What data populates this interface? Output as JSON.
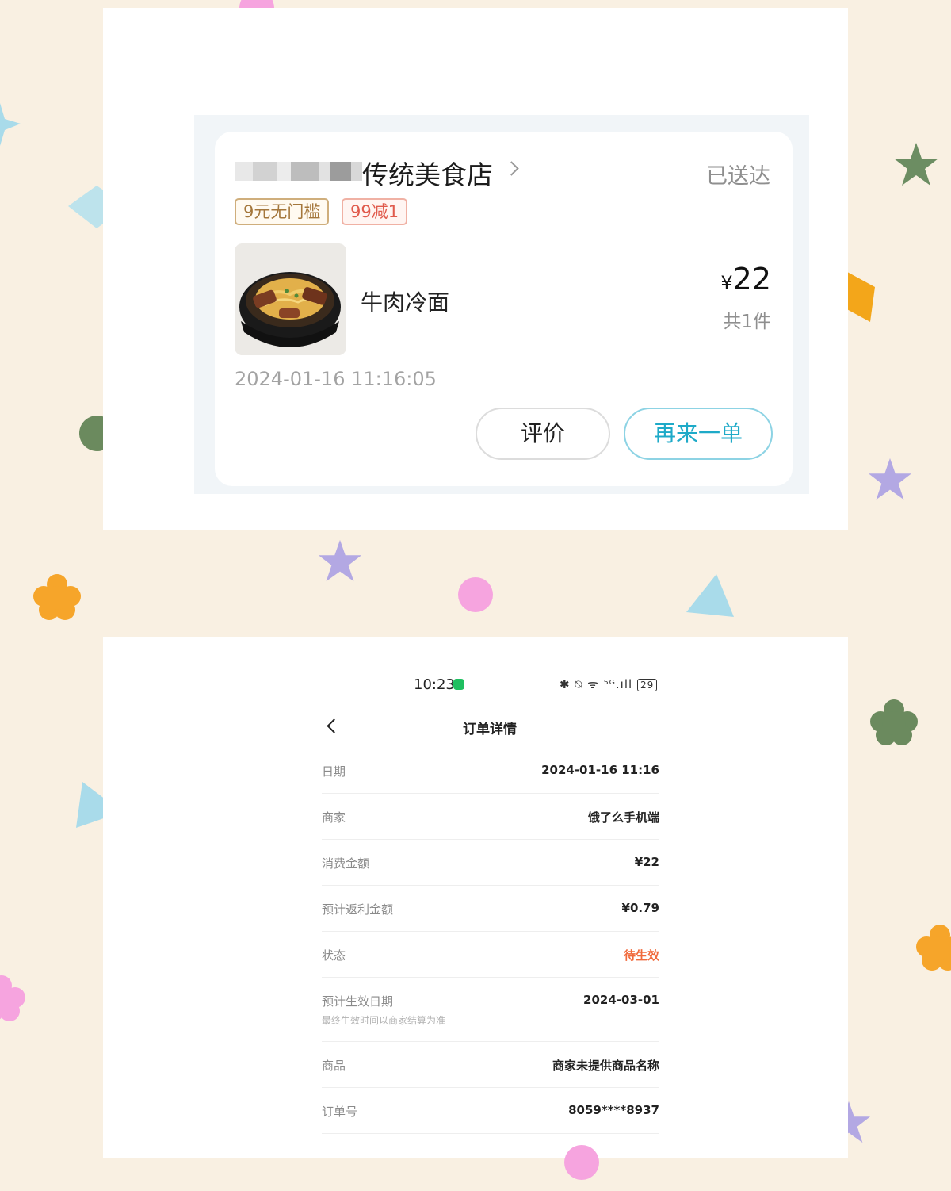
{
  "order_card": {
    "shop_name": "传统美食店",
    "status": "已送达",
    "coupons": [
      "9元无门槛",
      "99减1"
    ],
    "item_name": "牛肉冷面",
    "currency": "¥",
    "price": "22",
    "quantity": "共1件",
    "order_time": "2024-01-16 11:16:05",
    "review_label": "评价",
    "reorder_label": "再来一单"
  },
  "detail": {
    "status_bar": {
      "time": "10:23",
      "icons": "✱ ⍉ ᯤ ⁵ᴳ.ıll",
      "battery": "29"
    },
    "title": "订单详情",
    "rows": [
      {
        "label": "日期",
        "value": "2024-01-16 11:16"
      },
      {
        "label": "商家",
        "value": "饿了么手机端"
      },
      {
        "label": "消费金额",
        "value": "¥22"
      },
      {
        "label": "预计返利金额",
        "value": "¥0.79"
      },
      {
        "label": "状态",
        "value": "待生效"
      },
      {
        "label": "预计生效日期",
        "value": "2024-03-01",
        "note": "最终生效时间以商家结算为准"
      },
      {
        "label": "商品",
        "value": "商家未提供商品名称"
      },
      {
        "label": "订单号",
        "value": "8059****8937"
      }
    ]
  },
  "colors": {
    "background": "#f9f0e2",
    "accent_teal": "#1eaac8",
    "pending_orange": "#f06a3c",
    "coupon_gold": "#a4773c",
    "coupon_red": "#e05a4c"
  }
}
